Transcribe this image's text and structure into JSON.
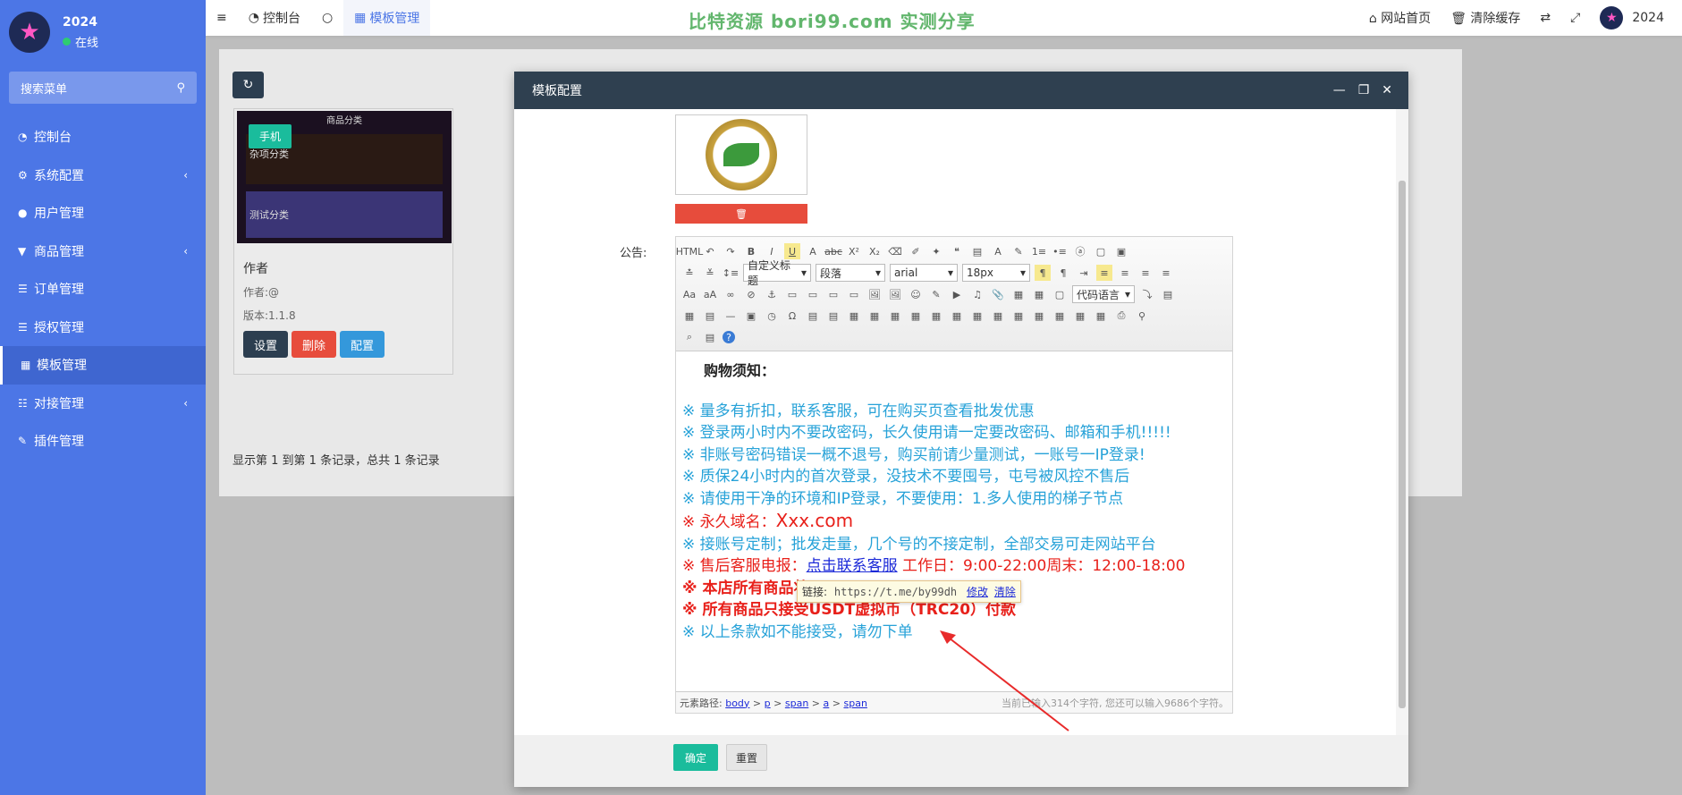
{
  "brand": {
    "name": "2024",
    "status": "在线"
  },
  "search": {
    "placeholder": "搜索菜单"
  },
  "sidebar": {
    "items": [
      {
        "label": "控制台"
      },
      {
        "label": "系统配置"
      },
      {
        "label": "用户管理"
      },
      {
        "label": "商品管理"
      },
      {
        "label": "订单管理"
      },
      {
        "label": "授权管理"
      },
      {
        "label": "模板管理"
      },
      {
        "label": "对接管理"
      },
      {
        "label": "插件管理"
      }
    ]
  },
  "topbar": {
    "tabs": [
      {
        "label": "控制台"
      },
      {
        "label": "模板管理"
      }
    ],
    "banner": "比特资源 bori99.com 实测分享",
    "home": "网站首页",
    "clear_cache": "清除缓存",
    "user": "2024"
  },
  "template_card": {
    "header": "商品分类",
    "cat1": "杂项分类",
    "cat2": "测试分类",
    "tag": "手机",
    "title": "作者",
    "author": "作者:@",
    "version": "版本:1.1.8",
    "settings": "设置",
    "delete": "删除",
    "config": "配置"
  },
  "records_text": "显示第 1 到第 1 条记录，总共 1 条记录",
  "modal": {
    "title": "模板配置",
    "notice_label": "公告:",
    "toolbar": {
      "custom_heading": "自定义标题",
      "paragraph": "段落",
      "font": "arial",
      "size": "18px",
      "code_lang": "代码语言"
    },
    "content": {
      "heading": "购物须知：",
      "lines": [
        "※ 量多有折扣，联系客服，可在购买页查看批发优惠",
        "※ 登录两小时内不要改密码，长久使用请一定要改密码、邮箱和手机!!!!!",
        "※ 非账号密码错误一概不退号，购买前请少量测试，一账号一IP登录!",
        "※ 质保24小时内的首次登录，没技术不要囤号，屯号被风控不售后",
        "※ 请使用干净的环境和IP登录，不要使用：1.多人使用的梯子节点"
      ],
      "domain_prefix": "※ 永久域名：",
      "domain": "Xxx.com",
      "custom_line": "※ 接账号定制；批发走量，几个号的不接定制，全部交易可走网站平台",
      "service_prefix": "※ 售后客服电报：",
      "service_link": "点击联系客服",
      "service_hours": " 工作日：9:00-22:00周末：12:00-18:00",
      "virtual_line": "※ 本店所有商品将",
      "usdt_line": "※  所有商品只接受USDT虚拟币（TRC20）付款",
      "last_line": "※ 以上条款如不能接受，请勿下单"
    },
    "link_popup": {
      "label": "链接:",
      "url": "https://t.me/by99dh",
      "edit": "修改",
      "clear": "清除"
    },
    "elpath": {
      "label": "元素路径:",
      "parts": [
        "body",
        "p",
        "span",
        "a",
        "span"
      ],
      "count": "当前已输入314个字符, 您还可以输入9686个字符。"
    },
    "confirm": "确定",
    "reset": "重置"
  }
}
